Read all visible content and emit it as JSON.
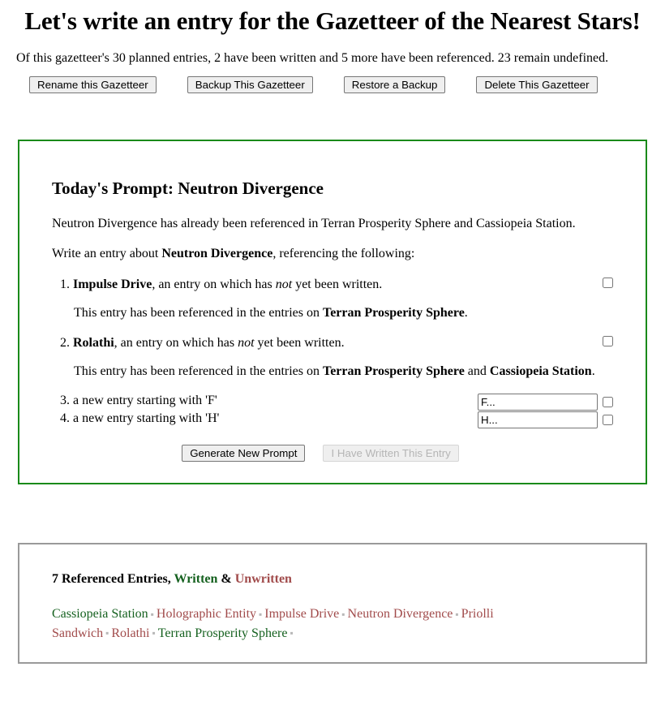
{
  "header": {
    "title": "Let's write an entry for the Gazetteer of the Nearest Stars!",
    "summary": "Of this gazetteer's 30 planned entries, 2 have been written and 5 more have been referenced. 23 remain undefined.",
    "buttons": [
      {
        "label": "Rename this Gazetteer"
      },
      {
        "label": "Backup This Gazetteer"
      },
      {
        "label": "Restore a Backup"
      },
      {
        "label": "Delete This Gazetteer"
      }
    ]
  },
  "prompt": {
    "title": "Today's Prompt: Neutron Divergence",
    "already_referenced": "Neutron Divergence has already been referenced in Terran Prosperity Sphere and Cassiopeia Station.",
    "instruction_prefix": "Write an entry about ",
    "instruction_subject": "Neutron Divergence",
    "instruction_suffix": ", referencing the following:",
    "items": [
      {
        "name": "Impulse Drive",
        "desc_before": ", an entry on which has ",
        "desc_emphasis": "not",
        "desc_after": " yet been written.",
        "note_prefix": "This entry has been referenced in the entries on ",
        "note_refs": [
          "Terran Prosperity Sphere"
        ],
        "note_suffix": ".",
        "checked": false
      },
      {
        "name": "Rolathi",
        "desc_before": ", an entry on which has ",
        "desc_emphasis": "not",
        "desc_after": " yet been written.",
        "note_prefix": "This entry has been referenced in the entries on ",
        "note_refs": [
          "Terran Prosperity Sphere",
          "Cassiopeia Station"
        ],
        "note_joiner": " and ",
        "note_suffix": ".",
        "checked": false
      },
      {
        "text": "a new entry starting with 'F'",
        "input_value": "F...",
        "checked": false
      },
      {
        "text": "a new entry starting with 'H'",
        "input_value": "H...",
        "checked": false
      }
    ],
    "generate_label": "Generate New Prompt",
    "written_label": "I Have Written This Entry",
    "written_disabled": true
  },
  "entries": {
    "heading_count": "7 Referenced Entries, ",
    "heading_written": "Written",
    "heading_amp": " & ",
    "heading_unwritten": "Unwritten",
    "separator": "▪",
    "list": [
      {
        "name": "Cassiopeia Station",
        "status": "written"
      },
      {
        "name": "Holographic Entity",
        "status": "unwritten"
      },
      {
        "name": "Impulse Drive",
        "status": "unwritten"
      },
      {
        "name": "Neutron Divergence",
        "status": "unwritten"
      },
      {
        "name": "Priolli Sandwich",
        "status": "unwritten"
      },
      {
        "name": "Rolathi",
        "status": "unwritten"
      },
      {
        "name": "Terran Prosperity Sphere",
        "status": "written"
      }
    ]
  },
  "colors": {
    "written": "#15611f",
    "unwritten": "#a14b4b",
    "prompt_border": "#1a8a1a",
    "entries_border": "#9a9a9a"
  }
}
